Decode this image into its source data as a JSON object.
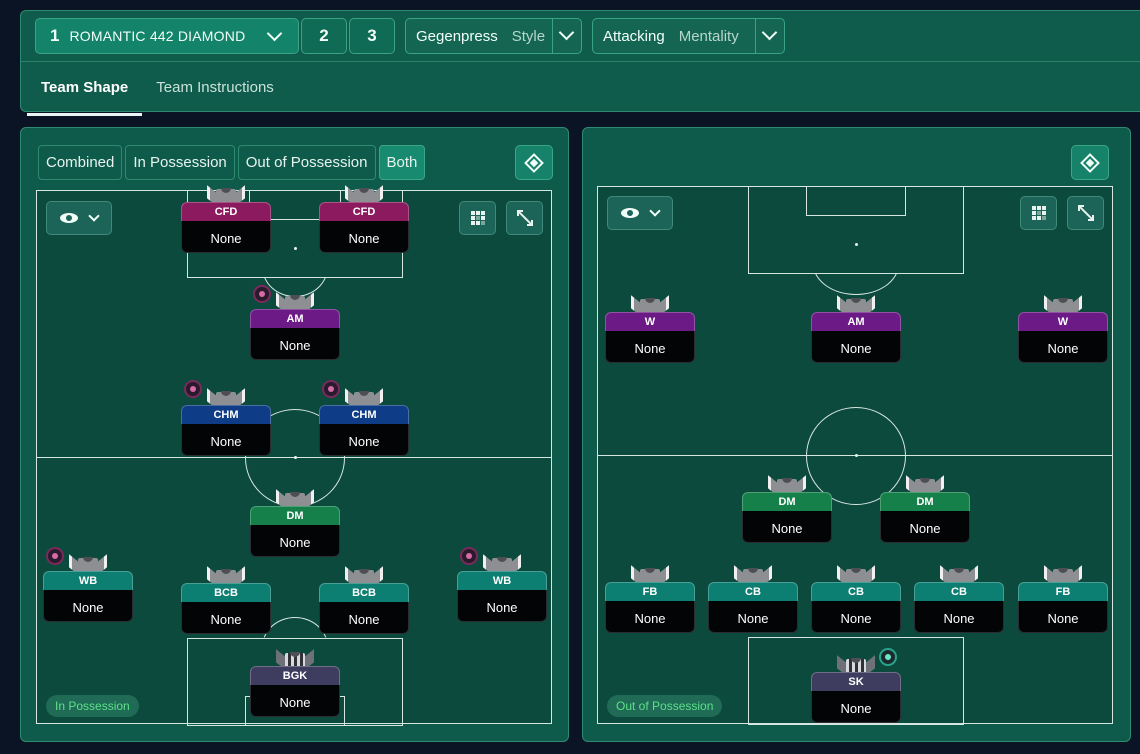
{
  "tactic": {
    "slot_number": "1",
    "name": "ROMANTIC 442 DIAMOND",
    "slots": [
      "2",
      "3"
    ],
    "style_value": "Gegenpress",
    "style_label": "Style",
    "mentality_value": "Attacking",
    "mentality_label": "Mentality"
  },
  "tabs": [
    "Team Shape",
    "Team Instructions"
  ],
  "active_tab": "Team Shape",
  "view_tabs": [
    "Combined",
    "In Possession",
    "Out of Possession",
    "Both"
  ],
  "active_view_tab": "Both",
  "left_pitch": {
    "phase_label": "In Possession",
    "players": [
      {
        "role": "CFD",
        "name": "None",
        "role_color": "#8b1a5e",
        "instruction_icon": false
      },
      {
        "role": "CFD",
        "name": "None",
        "role_color": "#8b1a5e",
        "instruction_icon": false
      },
      {
        "role": "AM",
        "name": "None",
        "role_color": "#6b1a86",
        "instruction_icon": true
      },
      {
        "role": "CHM",
        "name": "None",
        "role_color": "#0e3c86",
        "instruction_icon": true
      },
      {
        "role": "CHM",
        "name": "None",
        "role_color": "#0e3c86",
        "instruction_icon": true
      },
      {
        "role": "DM",
        "name": "None",
        "role_color": "#16804a",
        "instruction_icon": false
      },
      {
        "role": "WB",
        "name": "None",
        "role_color": "#0d7f72",
        "instruction_icon": true
      },
      {
        "role": "BCB",
        "name": "None",
        "role_color": "#0d7f72",
        "instruction_icon": false
      },
      {
        "role": "BCB",
        "name": "None",
        "role_color": "#0d7f72",
        "instruction_icon": false
      },
      {
        "role": "WB",
        "name": "None",
        "role_color": "#0d7f72",
        "instruction_icon": true
      },
      {
        "role": "BGK",
        "name": "None",
        "role_color": "#3f3d5f",
        "instruction_icon": false
      }
    ]
  },
  "right_pitch": {
    "phase_label": "Out of Possession",
    "players": [
      {
        "role": "W",
        "name": "None",
        "role_color": "#6b1a86",
        "instruction_icon": false
      },
      {
        "role": "AM",
        "name": "None",
        "role_color": "#6b1a86",
        "instruction_icon": false
      },
      {
        "role": "W",
        "name": "None",
        "role_color": "#6b1a86",
        "instruction_icon": false
      },
      {
        "role": "DM",
        "name": "None",
        "role_color": "#16804a",
        "instruction_icon": false
      },
      {
        "role": "DM",
        "name": "None",
        "role_color": "#16804a",
        "instruction_icon": false
      },
      {
        "role": "FB",
        "name": "None",
        "role_color": "#0d7f72",
        "instruction_icon": false
      },
      {
        "role": "CB",
        "name": "None",
        "role_color": "#0d7f72",
        "instruction_icon": false
      },
      {
        "role": "CB",
        "name": "None",
        "role_color": "#0d7f72",
        "instruction_icon": false
      },
      {
        "role": "CB",
        "name": "None",
        "role_color": "#0d7f72",
        "instruction_icon": false
      },
      {
        "role": "FB",
        "name": "None",
        "role_color": "#0d7f72",
        "instruction_icon": false
      },
      {
        "role": "SK",
        "name": "None",
        "role_color": "#3f3d5f",
        "instruction_icon": true
      }
    ]
  },
  "icons": {
    "tactic_dropdown": "chevron-down-icon",
    "board_toggle": "diamond-board-icon",
    "visibility": "eye-icon",
    "overlay": "grid-overlay-icon",
    "expand": "expand-icon",
    "instruction": "player-instruction-icon"
  }
}
